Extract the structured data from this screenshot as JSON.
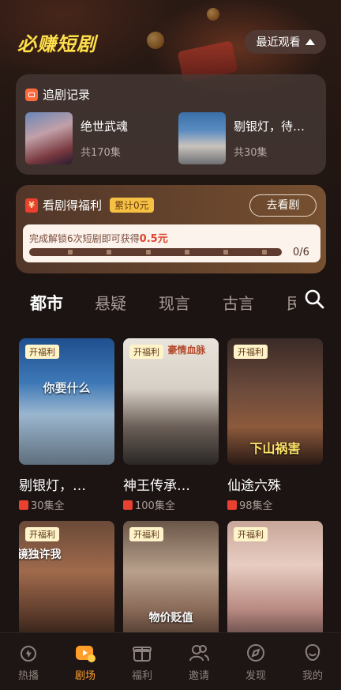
{
  "header": {
    "app_title": "必赚短剧",
    "recent_label": "最近观看"
  },
  "history": {
    "title": "追剧记录",
    "items": [
      {
        "name": "绝世武魂",
        "count": "共170集"
      },
      {
        "name": "剔银灯，待…",
        "count": "共30集"
      }
    ]
  },
  "welfare": {
    "title": "看剧得福利",
    "total_badge": "累计0元",
    "go_button": "去看剧",
    "progress_prefix": "完成解锁",
    "progress_count_text": "6次",
    "progress_mid": "短剧即可获得",
    "progress_reward": "0.5元",
    "progress_current": 0,
    "progress_total": 6,
    "progress_label": "0/6"
  },
  "tabs": [
    "都市",
    "悬疑",
    "现言",
    "古言",
    "民"
  ],
  "grid": [
    {
      "title": "剔银灯，…",
      "eps": "30集全",
      "badge": "开福利",
      "thumb_text": "你要什么"
    },
    {
      "title": "神王传承…",
      "eps": "100集全",
      "badge": "开福利",
      "thumb_text": "豪情血脉"
    },
    {
      "title": "仙途六殊",
      "eps": "98集全",
      "badge": "开福利",
      "thumb_text": "下山祸害"
    },
    {
      "title": "",
      "eps": "",
      "badge": "开福利",
      "thumb_text": "镜独许我"
    },
    {
      "title": "",
      "eps": "",
      "badge": "开福利",
      "thumb_text": "物价贬值"
    },
    {
      "title": "",
      "eps": "",
      "badge": "开福利",
      "thumb_text": ""
    }
  ],
  "nav": [
    {
      "label": "热播",
      "icon": "hot-icon"
    },
    {
      "label": "剧场",
      "icon": "theater-icon"
    },
    {
      "label": "福利",
      "icon": "gift-icon"
    },
    {
      "label": "邀请",
      "icon": "invite-icon"
    },
    {
      "label": "发现",
      "icon": "compass-icon"
    },
    {
      "label": "我的",
      "icon": "profile-icon"
    }
  ],
  "colors": {
    "accent": "#ff9e2a",
    "title_yellow": "#ffe04a",
    "reward_red": "#e0442c"
  }
}
